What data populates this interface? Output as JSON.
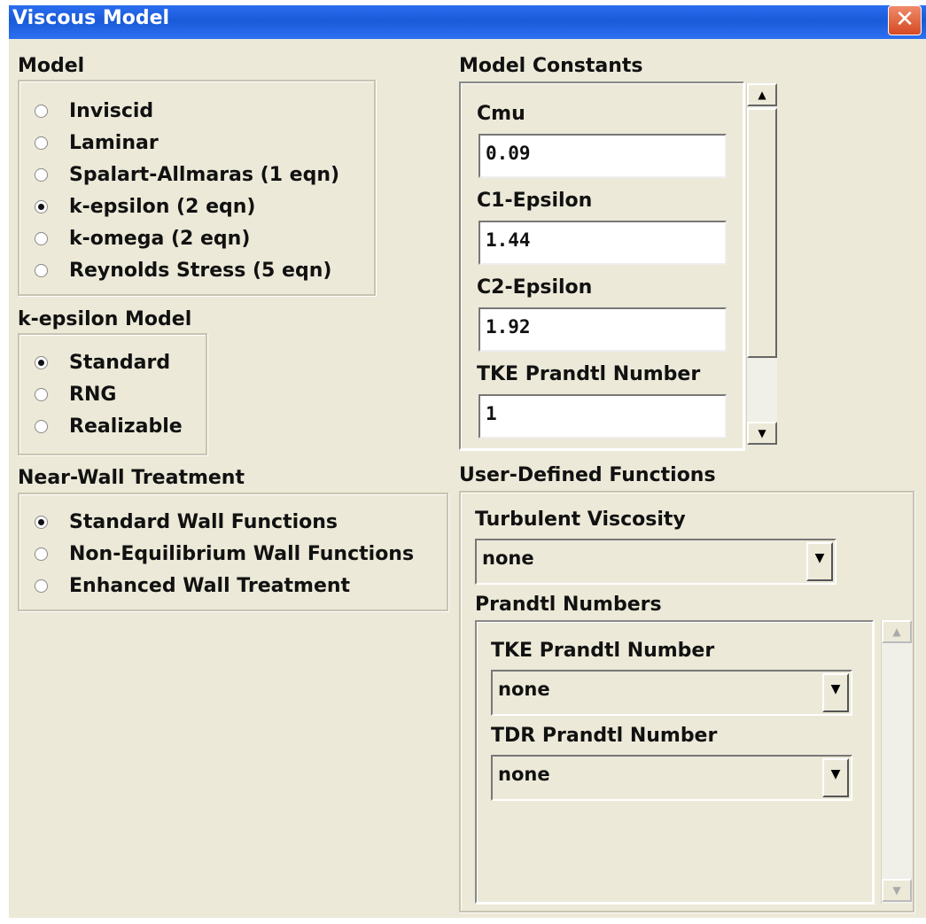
{
  "window": {
    "title": "Viscous Model",
    "close_glyph": "✕"
  },
  "model": {
    "label": "Model",
    "options": [
      {
        "label": "Inviscid",
        "selected": false
      },
      {
        "label": "Laminar",
        "selected": false
      },
      {
        "label": "Spalart-Allmaras   (1 eqn)",
        "selected": false
      },
      {
        "label": "k-epsilon   (2 eqn)",
        "selected": true
      },
      {
        "label": "k-omega   (2 eqn)",
        "selected": false
      },
      {
        "label": "Reynolds Stress   (5 eqn)",
        "selected": false
      }
    ]
  },
  "k_epsilon_model": {
    "label": "k-epsilon Model",
    "options": [
      {
        "label": "Standard",
        "selected": true
      },
      {
        "label": "RNG",
        "selected": false
      },
      {
        "label": "Realizable",
        "selected": false
      }
    ]
  },
  "near_wall": {
    "label": "Near-Wall Treatment",
    "options": [
      {
        "label": "Standard Wall Functions",
        "selected": true
      },
      {
        "label": "Non-Equilibrium Wall Functions",
        "selected": false
      },
      {
        "label": "Enhanced Wall Treatment",
        "selected": false
      }
    ]
  },
  "model_constants": {
    "label": "Model Constants",
    "fields": [
      {
        "label": "Cmu",
        "value": "0.09"
      },
      {
        "label": "C1-Epsilon",
        "value": "1.44"
      },
      {
        "label": "C2-Epsilon",
        "value": "1.92"
      },
      {
        "label": "TKE Prandtl Number",
        "value": "1"
      }
    ]
  },
  "udf": {
    "label": "User-Defined Functions",
    "turbulent_viscosity": {
      "label": "Turbulent Viscosity",
      "value": "none"
    },
    "prandtl": {
      "label": "Prandtl Numbers",
      "tke": {
        "label": "TKE Prandtl Number",
        "value": "none"
      },
      "tdr": {
        "label": "TDR Prandtl Number",
        "value": "none"
      }
    }
  },
  "icons": {
    "scroll_up": "▲",
    "scroll_down": "▼",
    "dropdown": "▼"
  }
}
